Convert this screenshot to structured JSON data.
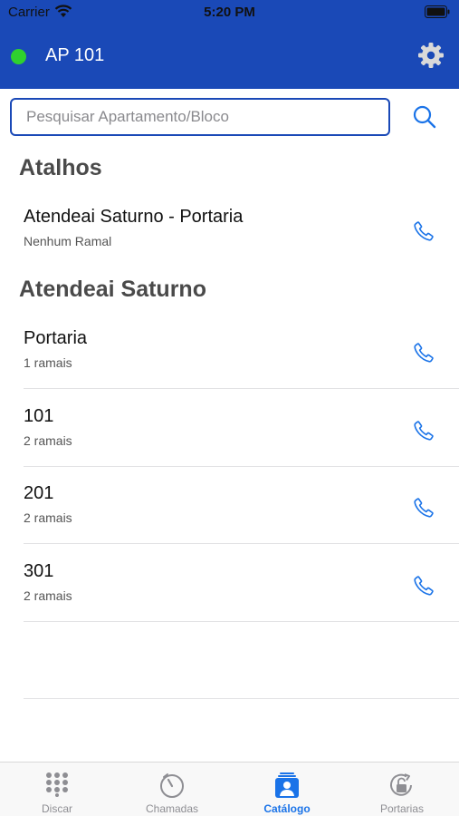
{
  "status_bar": {
    "carrier": "Carrier",
    "time": "5:20 PM"
  },
  "header": {
    "title": "AP 101",
    "status_color": "#2fd12f",
    "background": "#1a49b7"
  },
  "search": {
    "placeholder": "Pesquisar Apartamento/Bloco",
    "value": ""
  },
  "sections": [
    {
      "title": "Atalhos",
      "items": [
        {
          "title": "Atendeai Saturno - Portaria",
          "subtitle": "Nenhum Ramal"
        }
      ]
    },
    {
      "title": "Atendeai Saturno",
      "items": [
        {
          "title": "Portaria",
          "subtitle": "1 ramais"
        },
        {
          "title": "101",
          "subtitle": "2 ramais"
        },
        {
          "title": "201",
          "subtitle": "2 ramais"
        },
        {
          "title": "301",
          "subtitle": "2 ramais"
        }
      ]
    }
  ],
  "tabs": [
    {
      "label": "Discar",
      "icon": "keypad-icon",
      "active": false
    },
    {
      "label": "Chamadas",
      "icon": "recent-calls-icon",
      "active": false
    },
    {
      "label": "Catálogo",
      "icon": "contacts-icon",
      "active": true
    },
    {
      "label": "Portarias",
      "icon": "unlock-rotate-icon",
      "active": false
    }
  ],
  "colors": {
    "accent": "#1a73e8",
    "brand": "#1a49b7"
  }
}
